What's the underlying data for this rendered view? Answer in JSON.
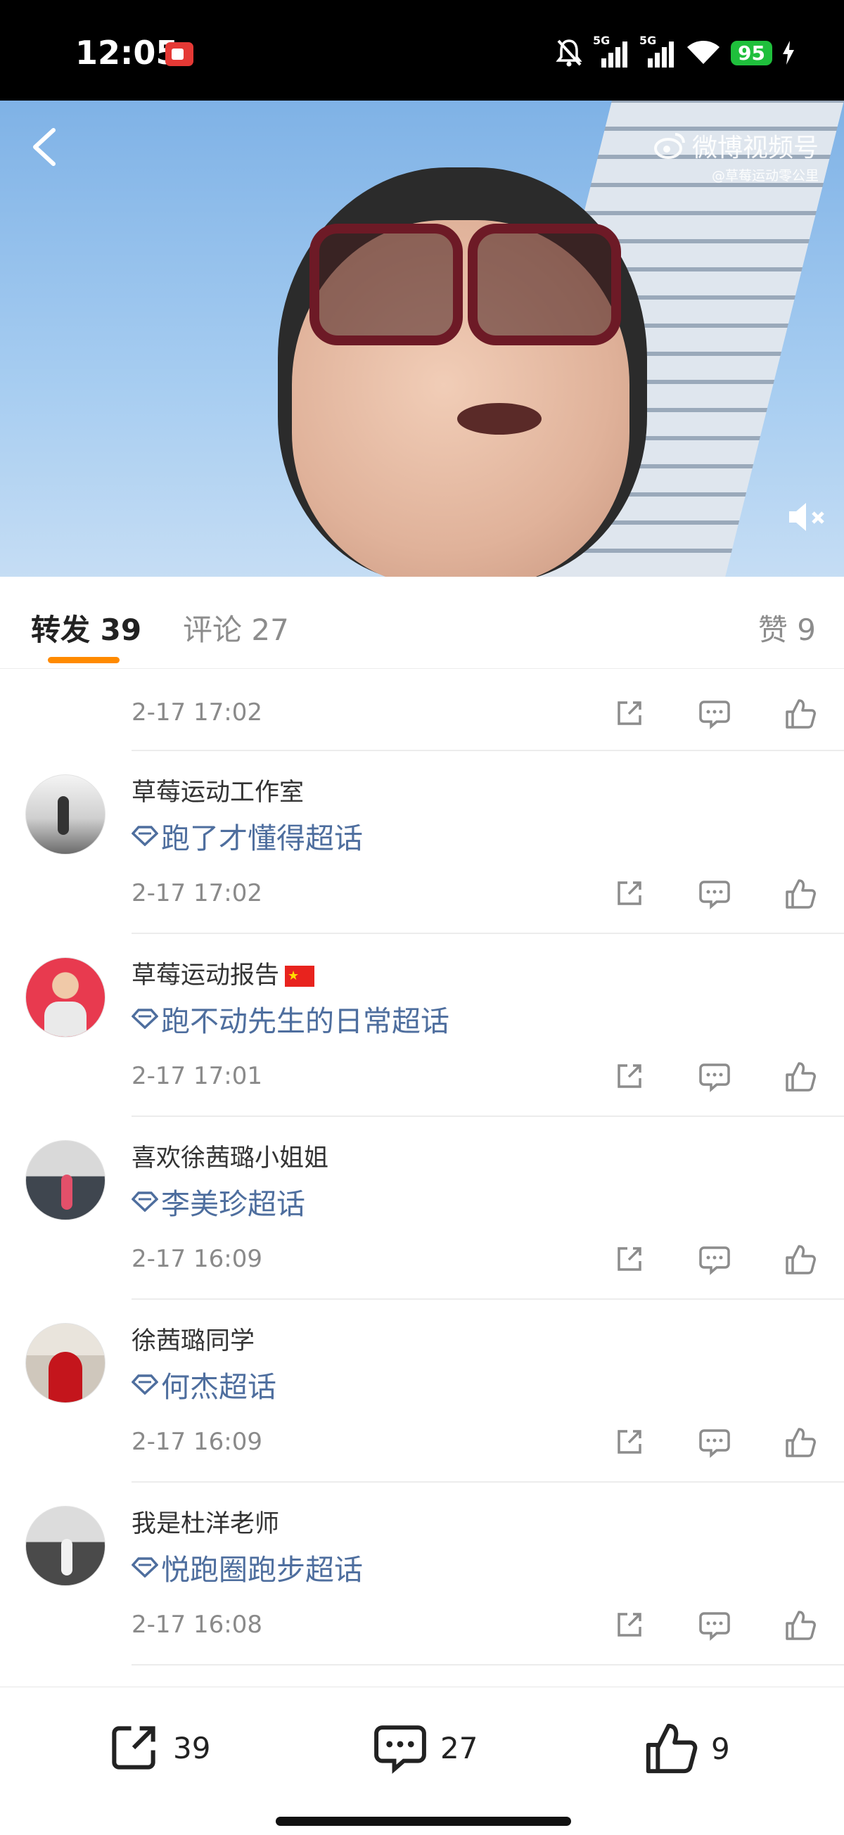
{
  "status_bar": {
    "time": "12:05",
    "network_1": "5G",
    "network_2": "5G",
    "battery": "95"
  },
  "video": {
    "watermark_main": "微博视频号",
    "watermark_sub": "@草莓运动零公里"
  },
  "tabs": {
    "repost_label": "转发",
    "repost_count": "39",
    "comment_label": "评论",
    "comment_count": "27",
    "like_label": "赞",
    "like_count": "9"
  },
  "list": {
    "partial_time": "2-17 17:02",
    "items": [
      {
        "name": "草莓运动工作室",
        "content": "跑了才懂得超话",
        "time": "2-17 17:02"
      },
      {
        "name": "草莓运动报告",
        "content": "跑不动先生的日常超话",
        "time": "2-17 17:01"
      },
      {
        "name": "喜欢徐茜璐小姐姐",
        "content": "李美珍超话",
        "time": "2-17 16:09"
      },
      {
        "name": "徐茜璐同学",
        "content": "何杰超话",
        "time": "2-17 16:09"
      },
      {
        "name": "我是杜洋老师",
        "content": "悦跑圈跑步超话",
        "time": "2-17 16:08"
      }
    ]
  },
  "bottom_bar": {
    "repost_count": "39",
    "comment_count": "27",
    "like_count": "9"
  },
  "colors": {
    "accent": "#ff8a00",
    "topic_link": "#4e6e9e",
    "battery": "#1fbf3c"
  },
  "icons": [
    "record-icon",
    "mute-notification-icon",
    "signal-icon",
    "wifi-icon",
    "charging-icon",
    "back-icon",
    "weibo-logo-icon",
    "sound-off-icon",
    "share-icon",
    "comment-icon",
    "like-icon",
    "supertopic-icon"
  ]
}
